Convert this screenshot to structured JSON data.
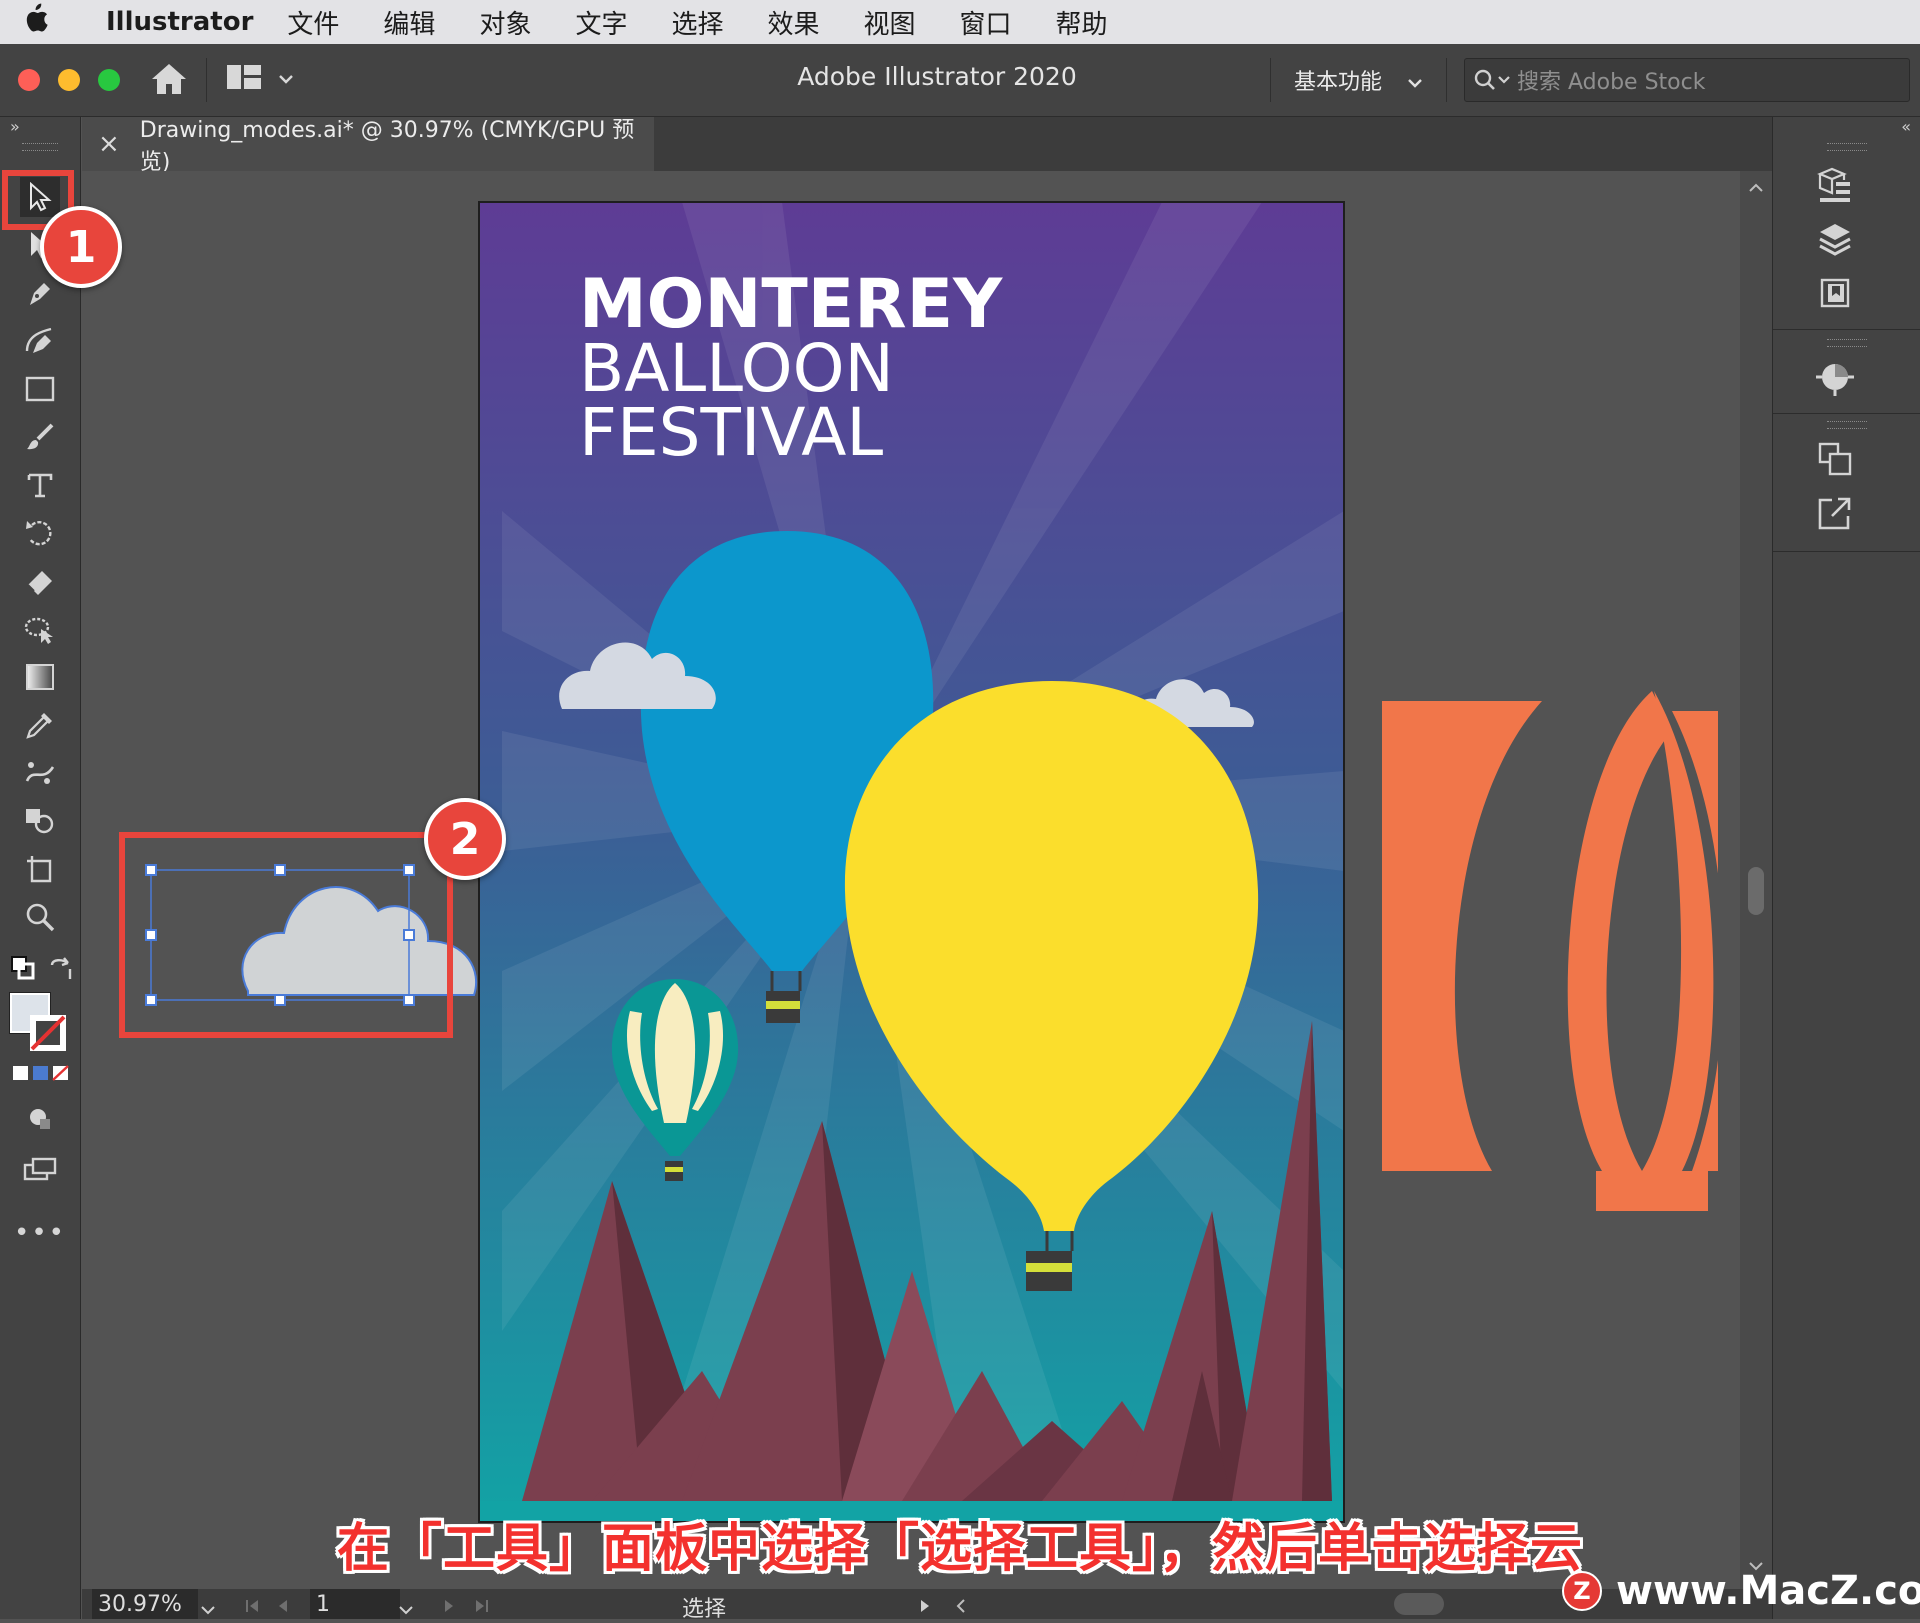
{
  "menubar": {
    "app_name": "Illustrator",
    "items": [
      "文件",
      "编辑",
      "对象",
      "文字",
      "选择",
      "效果",
      "视图",
      "窗口",
      "帮助"
    ]
  },
  "titlebar": {
    "title": "Adobe Illustrator 2020",
    "workspace": "基本功能",
    "search_placeholder": "搜索 Adobe Stock"
  },
  "document_tab": {
    "close": "×",
    "label": "Drawing_modes.ai* @ 30.97% (CMYK/GPU 预览)"
  },
  "artboard": {
    "title_line1": "MONTEREY",
    "title_line2": "BALLOON",
    "title_line3": "FESTIVAL"
  },
  "status": {
    "zoom": "30.97%",
    "page": "1",
    "tool": "选择"
  },
  "badges": {
    "one": "1",
    "two": "2"
  },
  "caption": "在「工具」面板中选择「选择工具」，然后单击选择云",
  "watermark": {
    "logo": "Z",
    "text": "www.MacZ.com"
  },
  "colors": {
    "accent_red": "#e8453c",
    "balloon_yellow": "#fbde2c",
    "balloon_blue": "#0c97cc",
    "balloon_orange": "#f1764a",
    "mountain": "#7b3f4e",
    "sky_top": "#5e3c95",
    "sky_bottom": "#12a3a5"
  }
}
